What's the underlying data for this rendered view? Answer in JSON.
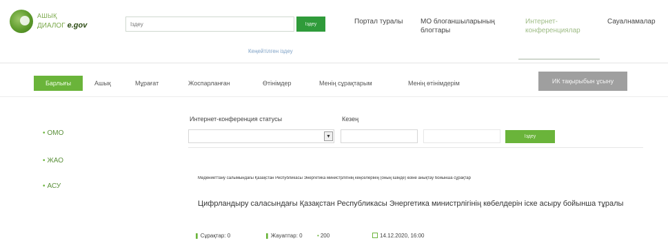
{
  "header": {
    "logo_line1": "АШЫҚ",
    "logo_line2": "ДИАЛОГ",
    "logo_egov": "e.gov",
    "search_placeholder": "Іздеу",
    "search_button": "Іздеу",
    "advanced_search": "Кеңейтілген іздеу",
    "nav": [
      "Портал туралы",
      "МО блоганшыларының блогтары",
      "Интернет-конференциялар",
      "Сауалнамалар"
    ]
  },
  "tabs": {
    "items": [
      "Барлығы",
      "Ашық",
      "Мұрағат",
      "Жоспарланған",
      "Өтінімдер",
      "Менің сұрақтарым",
      "Менің өтінімдерім"
    ],
    "right_button": "ИК тақырыбын ұсыну",
    "active_index": 0
  },
  "sidebar": {
    "items": [
      "ОМО",
      "ЖАО",
      "АСУ"
    ]
  },
  "filters": {
    "status_label": "Интернет-конференция статусы",
    "period_label": "Кезең",
    "apply_button": "Іздеу"
  },
  "item": {
    "small_text": "Мәдениеттану салымындағы Қазақстан Республикасы Энергетика министрлігінің кеңселерінің (оның ішінде) өзіне анықтау бойынша сұрақтар",
    "title": "Цифрландыру саласындағы Қазақстан Республикасы Энергетика министрлігінің көбелдерін іске асыру бойынша тұралы",
    "meta": {
      "questions": "Сұрақтар: 0",
      "answers": "Жауаптар: 0",
      "views": "200",
      "date": "14.12.2020, 16:00"
    }
  },
  "colors": {
    "accent": "#6ab43a",
    "search_green": "#2f9b3a",
    "button_gray": "#9f9f9f"
  }
}
